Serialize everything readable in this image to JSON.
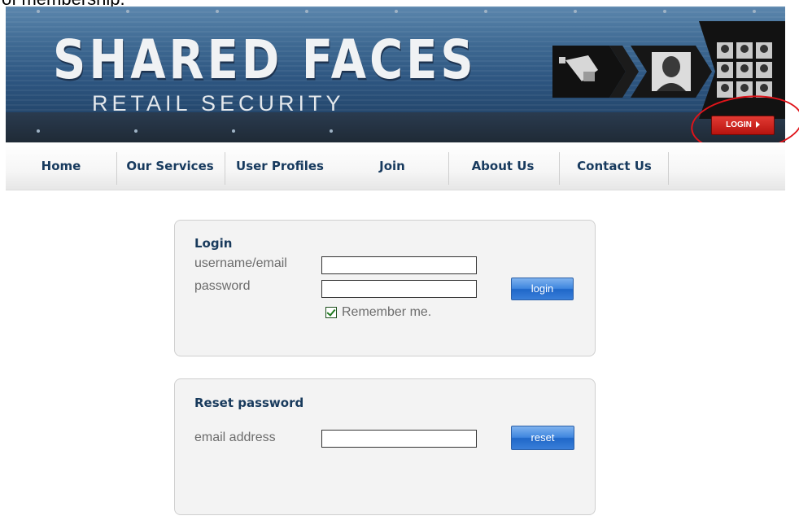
{
  "caption": {
    "text": "of membership."
  },
  "header": {
    "title": "SHARED FACES",
    "subtitle": "RETAIL SECURITY",
    "login_badge": "LOGIN"
  },
  "nav": {
    "items": [
      {
        "label": "Home"
      },
      {
        "label": "Our Services"
      },
      {
        "label": "User Profiles"
      },
      {
        "label": "Join"
      },
      {
        "label": "About Us"
      },
      {
        "label": "Contact Us"
      }
    ]
  },
  "login_panel": {
    "title": "Login",
    "username_label": "username/email",
    "username_value": "",
    "password_label": "password",
    "password_value": "",
    "remember_label": "Remember me.",
    "remember_checked": true,
    "submit_label": "login"
  },
  "reset_panel": {
    "title": "Reset password",
    "email_label": "email address",
    "email_value": "",
    "submit_label": "reset"
  },
  "colors": {
    "accent_blue": "#3f86df",
    "nav_text": "#173a5e",
    "badge_red": "#c9201a",
    "annotation_red": "#e0141a"
  },
  "icons": {
    "header_graphic": [
      "camera-icon",
      "arrow-icon",
      "face-portrait-icon",
      "face-grid-icon"
    ],
    "badge_arrow": "triangle-right-icon",
    "checkbox_mark": "checkmark-icon"
  }
}
